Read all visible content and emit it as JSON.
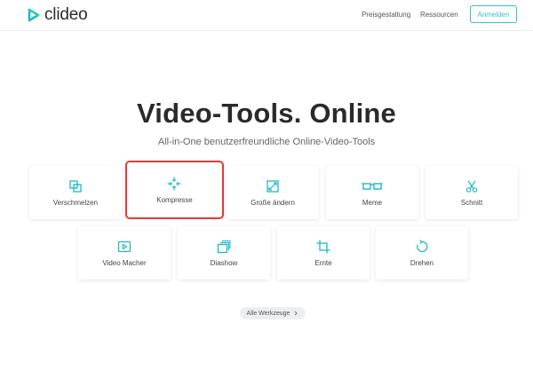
{
  "header": {
    "logo_text": "clideo",
    "nav": {
      "pricing": "Preisgestaltung",
      "resources": "Ressourcen"
    },
    "login_label": "Anmelden"
  },
  "hero": {
    "title": "Video-Tools. Online",
    "subtitle": "All-in-One benutzerfreundliche Online-Video-Tools"
  },
  "tools": {
    "merge": "Verschmelzen",
    "compress": "Kompresse",
    "resize": "Große ändern",
    "meme": "Meme",
    "cut": "Schnitt",
    "video_maker": "Video Macher",
    "slideshow": "Diashow",
    "crop": "Ernte",
    "rotate": "Drehen"
  },
  "all_tools_label": "Alle Werkzeuge",
  "colors": {
    "accent": "#1fb8c6",
    "highlight": "#e53935",
    "login_border": "#38bcd6"
  },
  "icons": {
    "merge": "merge-icon",
    "compress": "compress-icon",
    "resize": "resize-icon",
    "meme": "glasses-icon",
    "cut": "scissors-icon",
    "video_maker": "play-icon",
    "slideshow": "slides-icon",
    "crop": "crop-icon",
    "rotate": "rotate-icon"
  }
}
